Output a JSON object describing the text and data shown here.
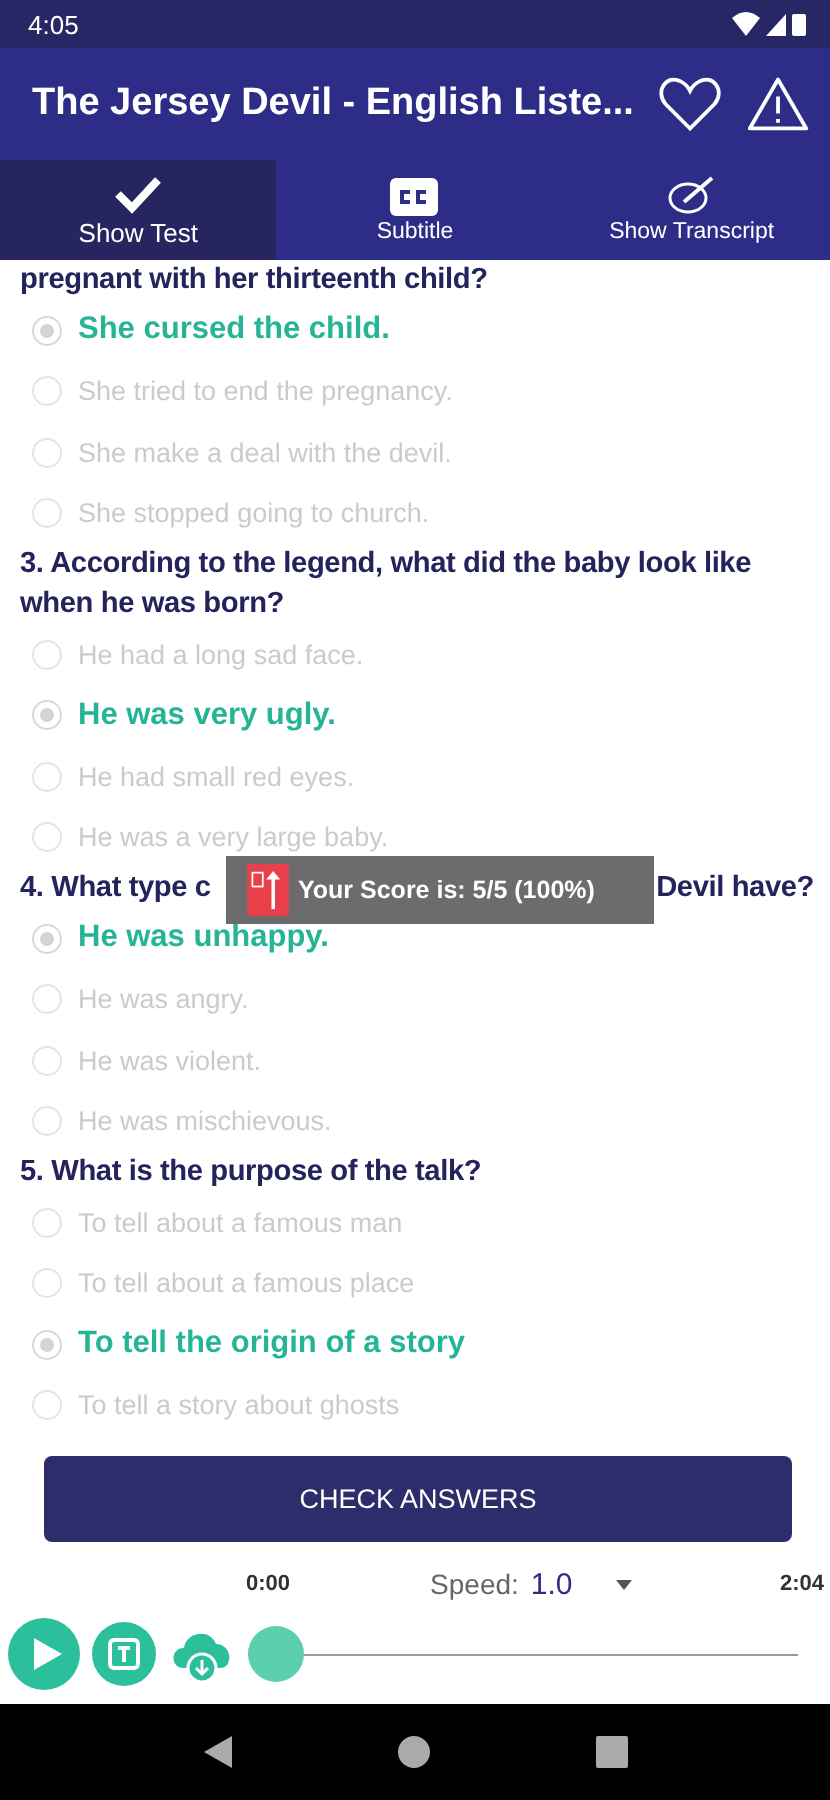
{
  "status_bar": {
    "time": "4:05"
  },
  "app_bar": {
    "title": "The Jersey Devil - English Liste..."
  },
  "tabs": [
    {
      "label": "Show Test",
      "selected": true
    },
    {
      "label": "Subtitle",
      "selected": false
    },
    {
      "label": "Show Transcript",
      "selected": false
    }
  ],
  "questions": [
    {
      "question": [
        "pregnant with her thirteenth child?"
      ],
      "options": [
        {
          "text": "She cursed the child.",
          "selected": true
        },
        {
          "text": "She tried to end the pregnancy.",
          "selected": false
        },
        {
          "text": "She make a deal with the devil.",
          "selected": false
        },
        {
          "text": "She stopped going to church.",
          "selected": false
        }
      ]
    },
    {
      "question": [
        "3. According to the legend, what did the baby look like when he was born?"
      ],
      "options": [
        {
          "text": "He had a long sad face.",
          "selected": false
        },
        {
          "text": "He was very ugly.",
          "selected": true
        },
        {
          "text": "He had small red eyes.",
          "selected": false
        },
        {
          "text": "He was a very large baby.",
          "selected": false
        }
      ]
    },
    {
      "question": [
        "4. What type c",
        "Devil have?"
      ],
      "options": [
        {
          "text": "He was unhappy.",
          "selected": true
        },
        {
          "text": "He was angry.",
          "selected": false
        },
        {
          "text": "He was violent.",
          "selected": false
        },
        {
          "text": "He was mischievous.",
          "selected": false
        }
      ]
    },
    {
      "question": [
        "5. What is the purpose of the talk?"
      ],
      "options": [
        {
          "text": "To tell about a famous man",
          "selected": false
        },
        {
          "text": "To tell about a famous place",
          "selected": false
        },
        {
          "text": "To tell the origin of a story",
          "selected": true
        },
        {
          "text": "To tell a story about ghosts",
          "selected": false
        }
      ]
    }
  ],
  "toast": {
    "text": "Your Score is: 5/5  (100%)"
  },
  "check_button": "CHECK ANSWERS",
  "player": {
    "current_time": "0:00",
    "speed_label": "Speed:",
    "speed": "1.0",
    "total_time": "2:04",
    "level": 0
  }
}
